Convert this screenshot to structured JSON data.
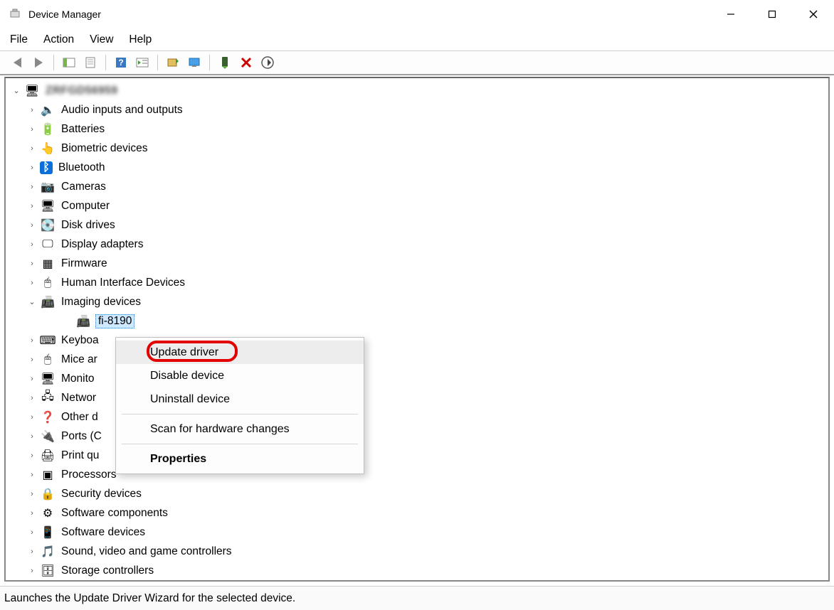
{
  "window": {
    "title": "Device Manager"
  },
  "menu": {
    "file": "File",
    "action": "Action",
    "view": "View",
    "help": "Help"
  },
  "toolbar_icons": {
    "back": "back-arrow-icon",
    "forward": "forward-arrow-icon",
    "show_hide_tree": "show-hide-console-tree-icon",
    "properties": "properties-icon",
    "help": "help-icon",
    "action_list": "action-icon",
    "update_driver": "update-driver-icon",
    "monitor": "show-hidden-devices-icon",
    "enable": "enable-device-icon",
    "disable": "disable-device-icon",
    "scan": "scan-hardware-icon"
  },
  "tree": {
    "root_label": "ZRFGD56959",
    "categories": [
      {
        "label": "Audio inputs and outputs",
        "icon": "speaker-icon"
      },
      {
        "label": "Batteries",
        "icon": "battery-icon"
      },
      {
        "label": "Biometric devices",
        "icon": "fingerprint-icon"
      },
      {
        "label": "Bluetooth",
        "icon": "bluetooth-icon"
      },
      {
        "label": "Cameras",
        "icon": "camera-icon"
      },
      {
        "label": "Computer",
        "icon": "computer-icon"
      },
      {
        "label": "Disk drives",
        "icon": "disk-icon"
      },
      {
        "label": "Display adapters",
        "icon": "display-adapter-icon"
      },
      {
        "label": "Firmware",
        "icon": "firmware-icon"
      },
      {
        "label": "Human Interface Devices",
        "icon": "hid-icon"
      },
      {
        "label": "Imaging devices",
        "icon": "imaging-icon",
        "expanded": true,
        "children": [
          {
            "label": "fi-8190",
            "icon": "scanner-icon",
            "selected": true
          }
        ]
      },
      {
        "label": "Keyboa",
        "icon": "keyboard-icon"
      },
      {
        "label": "Mice ar",
        "icon": "mouse-icon"
      },
      {
        "label": "Monito",
        "icon": "monitor-icon"
      },
      {
        "label": "Networ",
        "icon": "network-icon"
      },
      {
        "label": "Other d",
        "icon": "other-device-icon"
      },
      {
        "label": "Ports (C",
        "icon": "port-icon"
      },
      {
        "label": "Print qu",
        "icon": "printer-icon"
      },
      {
        "label": "Processors",
        "icon": "processor-icon"
      },
      {
        "label": "Security devices",
        "icon": "security-icon"
      },
      {
        "label": "Software components",
        "icon": "software-component-icon"
      },
      {
        "label": "Software devices",
        "icon": "software-device-icon"
      },
      {
        "label": "Sound, video and game controllers",
        "icon": "sound-icon"
      },
      {
        "label": "Storage controllers",
        "icon": "storage-icon"
      }
    ]
  },
  "context_menu": {
    "update_driver": "Update driver",
    "disable_device": "Disable device",
    "uninstall_device": "Uninstall device",
    "scan_hardware": "Scan for hardware changes",
    "properties": "Properties"
  },
  "statusbar": {
    "text": "Launches the Update Driver Wizard for the selected device."
  },
  "icon_glyphs": {
    "speaker-icon": "🔈",
    "battery-icon": "🔋",
    "fingerprint-icon": "👆",
    "bluetooth-icon": "ᛒ",
    "camera-icon": "📷",
    "computer-icon": "🖥",
    "disk-icon": "💽",
    "display-adapter-icon": "🖵",
    "firmware-icon": "▦",
    "hid-icon": "🖱",
    "imaging-icon": "📠",
    "scanner-icon": "📠",
    "keyboard-icon": "⌨",
    "mouse-icon": "🖱",
    "monitor-icon": "🖥",
    "network-icon": "🖧",
    "other-device-icon": "❓",
    "port-icon": "🔌",
    "printer-icon": "🖨",
    "processor-icon": "▣",
    "security-icon": "🔒",
    "software-component-icon": "⚙",
    "software-device-icon": "📱",
    "sound-icon": "🎵",
    "storage-icon": "🗄",
    "pc-icon": "🖥"
  }
}
